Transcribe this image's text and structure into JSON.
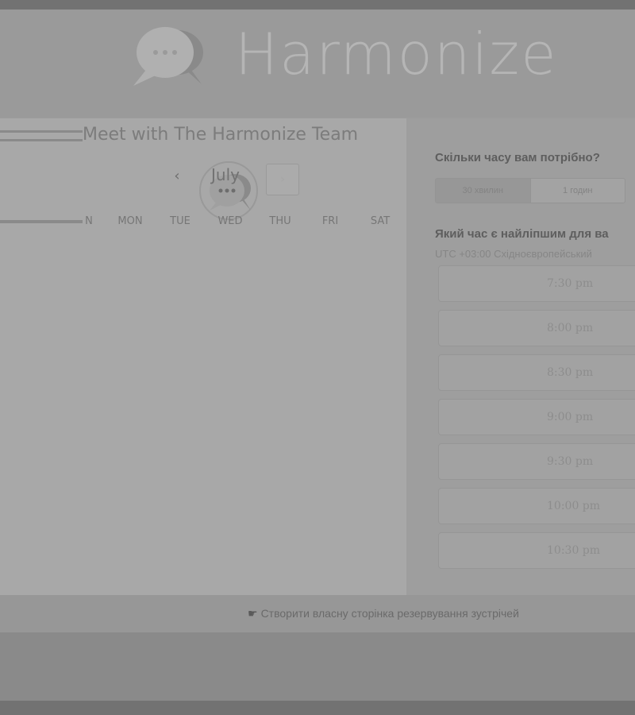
{
  "brand": {
    "name": "Harmonize"
  },
  "calendar": {
    "meeting_title": "Meet with The Harmonize Team",
    "month": "July",
    "prev_label": "‹",
    "next_label": "›",
    "weekdays": [
      "N",
      "MON",
      "TUE",
      "WED",
      "THU",
      "FRI",
      "SAT"
    ]
  },
  "booking": {
    "duration_question": "Скільки часу вам потрібно?",
    "duration_options": [
      "30 хвилин",
      "1 годин"
    ],
    "time_question": "Який час є найліпшим для ва",
    "timezone": "UTC +03:00 Східноєвропейський",
    "slots": [
      "7:30 pm",
      "8:00 pm",
      "8:30 pm",
      "9:00 pm",
      "9:30 pm",
      "10:00 pm",
      "10:30 pm"
    ]
  },
  "footer": {
    "link_text": "Створити власну сторінка резервування зустрічей"
  },
  "colors": {
    "overlay_background": "#727272",
    "card_background": "#a8a8a8"
  },
  "icons": {
    "logo": "chat-bubbles-icon",
    "avatar": "chat-bubbles-icon",
    "footer": "hand-pointer-icon"
  }
}
